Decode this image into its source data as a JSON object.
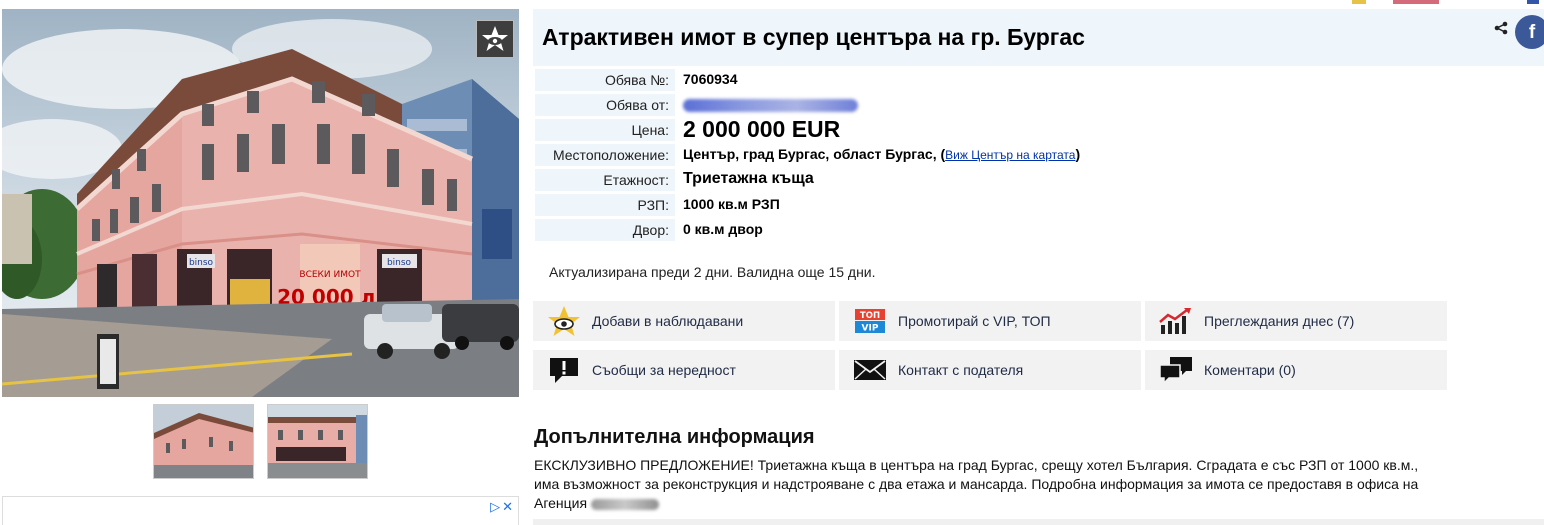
{
  "listing": {
    "title": "Атрактивен имот в супер центъра на гр. Бургас",
    "details": [
      {
        "label": "Обява №:",
        "value": "7060934"
      },
      {
        "label": "Обява от:",
        "value": ""
      },
      {
        "label": "Цена:",
        "value": "2 000 000 EUR"
      },
      {
        "label": "Местоположение:",
        "value": "Център, град Бургас, област Бургас,",
        "link": "Виж Център на картата"
      },
      {
        "label": "Етажност:",
        "value": "Триетажна къща"
      },
      {
        "label": "РЗП:",
        "value": "1000 кв.м РЗП"
      },
      {
        "label": "Двор:",
        "value": "0 кв.м двор"
      }
    ],
    "updated": "Актуализирана преди 2 дни. Валидна още 15 дни."
  },
  "actions": [
    {
      "label": "Добави в наблюдавани",
      "icon": "star-eye-icon"
    },
    {
      "label": "Промотирай с VIP, ТОП",
      "icon": "vip-top-icon"
    },
    {
      "label": "Преглеждания днес (7)",
      "icon": "trend-chart-icon"
    },
    {
      "label": "Съобщи за нередност",
      "icon": "report-icon"
    },
    {
      "label": "Контакт с подателя",
      "icon": "envelope-icon"
    },
    {
      "label": "Коментари (0)",
      "icon": "comments-icon"
    }
  ],
  "extra_info": {
    "heading": "Допълнителна информация",
    "text_line1": "ЕКСКЛУЗИВНО ПРЕДЛОЖЕНИЕ! Триетажна къща в центъра на град Бургас, срещу хотел България. Сградата е със РЗП от 1000 кв.м.,",
    "text_line2": "има възможност за реконструкция и надстрояване с два етажа и мансарда. Подробна информация за имота се предоставя в офиса на",
    "text_line3": "Агенция"
  },
  "photo_signs": {
    "shop_sign": "binso",
    "sale_banner": "20 000 л.",
    "vip": "VIP",
    "top": "ТОП"
  },
  "social": {
    "facebook": "f"
  },
  "colors": {
    "accent_blue": "#eef5fb",
    "facebook": "#3b5998",
    "action_bg": "#f2f2f2",
    "link": "#0033aa"
  }
}
